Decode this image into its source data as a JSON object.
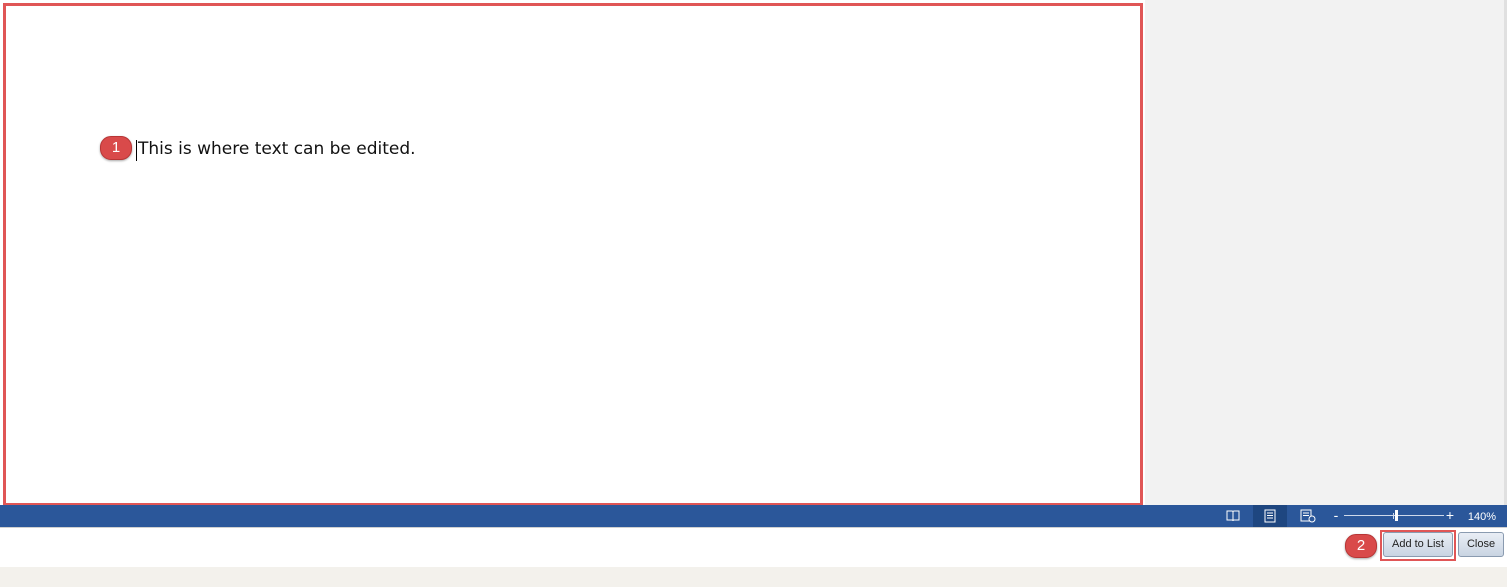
{
  "document": {
    "text": "This is where text can be edited."
  },
  "callouts": {
    "first": "1",
    "second": "2"
  },
  "status_bar": {
    "zoom_minus": "-",
    "zoom_plus": "+",
    "zoom_level": "140%",
    "zoom_percent": 140,
    "icons": [
      "read-mode-icon",
      "print-layout-icon",
      "web-layout-icon"
    ]
  },
  "buttons": {
    "add_to_list": "Add to List",
    "close": "Close"
  },
  "colors": {
    "status_bar": "#2b579a",
    "highlight": "#e05656",
    "callout": "#d94a4a"
  }
}
